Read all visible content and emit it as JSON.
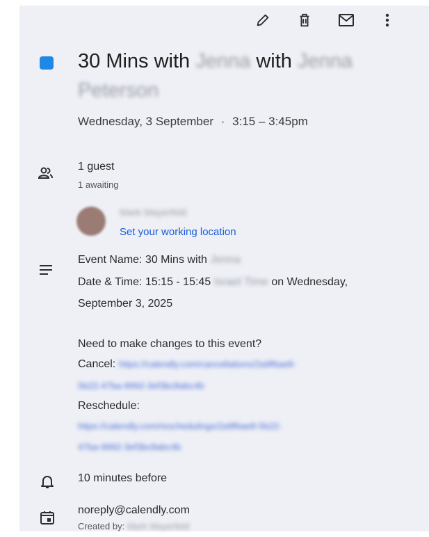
{
  "toolbar": {
    "edit_icon": "pencil",
    "delete_icon": "trash",
    "email_icon": "envelope",
    "more_icon": "vertical-dots"
  },
  "event": {
    "color": "#1e88e5",
    "title_prefix": "30 Mins with",
    "title_name1": "Jenna",
    "title_with": "with",
    "title_name2": "Jenna",
    "title_line2": "Peterson",
    "date": "Wednesday, 3 September",
    "separator": "·",
    "time": "3:15 – 3:45pm"
  },
  "guests": {
    "count_label": "1 guest",
    "awaiting_label": "1 awaiting",
    "guest_name": "Mark Mayerfeld",
    "working_location_link": "Set your working location"
  },
  "description": {
    "line1_prefix": "Event Name: 30 Mins with",
    "line1_name": "Jenna",
    "line2_prefix": "Date & Time: 15:15 - 15:45",
    "line2_tz": "Israel Time",
    "line2_suffix": "on Wednesday,",
    "line3": "September 3, 2025",
    "changes_question": "Need to make changes to this event?",
    "cancel_label": "Cancel:",
    "cancel_url_1": "https://calendly.com/cancellations/2a9f6ae8-",
    "cancel_url_2": "5b22-47ba-9992-3ef3bc8abc4b",
    "reschedule_label": "Reschedule:",
    "reschedule_url_1": "https://calendly.com/reschedulings/2a9f6ae8-5b22-",
    "reschedule_url_2": "47ba-9992-3ef3bc8abc4b"
  },
  "reminder": {
    "label": "10 minutes before"
  },
  "organizer": {
    "email": "noreply@calendly.com",
    "created_by_label": "Created by:",
    "created_by_name": "Mark Mayerfeld"
  }
}
